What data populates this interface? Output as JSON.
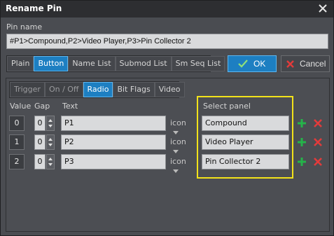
{
  "window": {
    "title": "Rename Pin"
  },
  "pin_name": {
    "label": "Pin name",
    "value": "#P1>Compound,P2>Video Player,P3>Pin Collector 2"
  },
  "type_tabs": [
    {
      "label": "Plain",
      "active": false
    },
    {
      "label": "Button",
      "active": true
    },
    {
      "label": "Name List",
      "active": false
    },
    {
      "label": "Submod List",
      "active": false
    },
    {
      "label": "Sm Seq List",
      "active": false
    }
  ],
  "actions": {
    "ok": "OK",
    "cancel": "Cancel"
  },
  "mode_tabs": [
    {
      "label": "Trigger",
      "active": false,
      "dim": true
    },
    {
      "label": "On / Off",
      "active": false,
      "dim": true
    },
    {
      "label": "Radio",
      "active": true,
      "dim": false
    },
    {
      "label": "Bit Flags",
      "active": false,
      "dim": false
    },
    {
      "label": "Video",
      "active": false,
      "dim": false
    }
  ],
  "columns": {
    "value": "Value",
    "gap": "Gap",
    "text": "Text",
    "select_panel": "Select panel"
  },
  "icon_label": "icon",
  "rows": [
    {
      "value": "0",
      "gap": "0",
      "text": "P1",
      "panel": "Compound"
    },
    {
      "value": "1",
      "gap": "0",
      "text": "P2",
      "panel": "Video Player"
    },
    {
      "value": "2",
      "gap": "0",
      "text": "P3",
      "panel": "Pin Collector 2"
    }
  ],
  "colors": {
    "accent": "#1d7fc2",
    "highlight": "#f3e21a",
    "add": "#25b34a",
    "delete": "#e23b3b"
  }
}
